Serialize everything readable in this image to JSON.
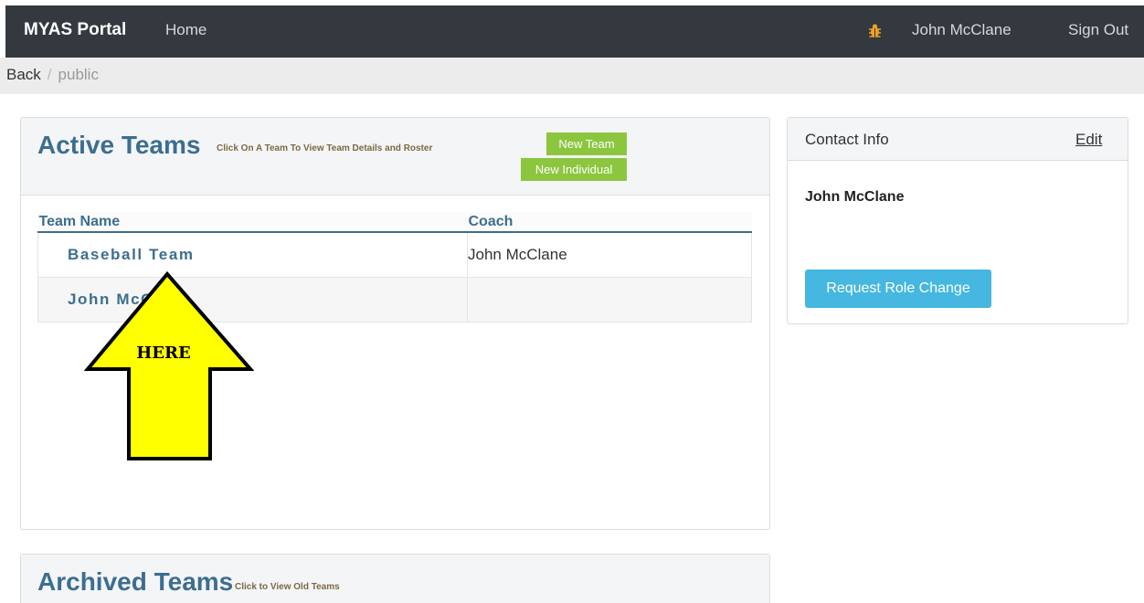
{
  "navbar": {
    "brand": "MYAS Portal",
    "home": "Home",
    "user": "John McClane",
    "signout": "Sign Out",
    "bug_icon": "bug-icon",
    "bug_color": "#f0a020"
  },
  "breadcrumb": {
    "back": "Back",
    "separator": "/",
    "current": "public"
  },
  "active_teams": {
    "title": "Active Teams",
    "hint": "Click On A Team To View Team Details and Roster",
    "new_team": "New Team",
    "new_individual": "New Individual",
    "columns": [
      "Team Name",
      "Coach"
    ],
    "rows": [
      {
        "team": "Baseball Team",
        "coach": "John McClane"
      },
      {
        "team": "John McClane",
        "coach": ""
      }
    ]
  },
  "annotation": {
    "label": "HERE",
    "fill": "#ffff00"
  },
  "contact": {
    "title": "Contact Info",
    "edit": "Edit",
    "name": "John McClane",
    "request_button": "Request Role Change"
  },
  "archived_teams": {
    "title": "Archived Teams",
    "hint": "Click to View Old Teams"
  },
  "colors": {
    "navbar": "#33393f",
    "accent": "#3c6e8f",
    "green_button": "#8cc63f",
    "blue_button": "#45b7e0"
  }
}
